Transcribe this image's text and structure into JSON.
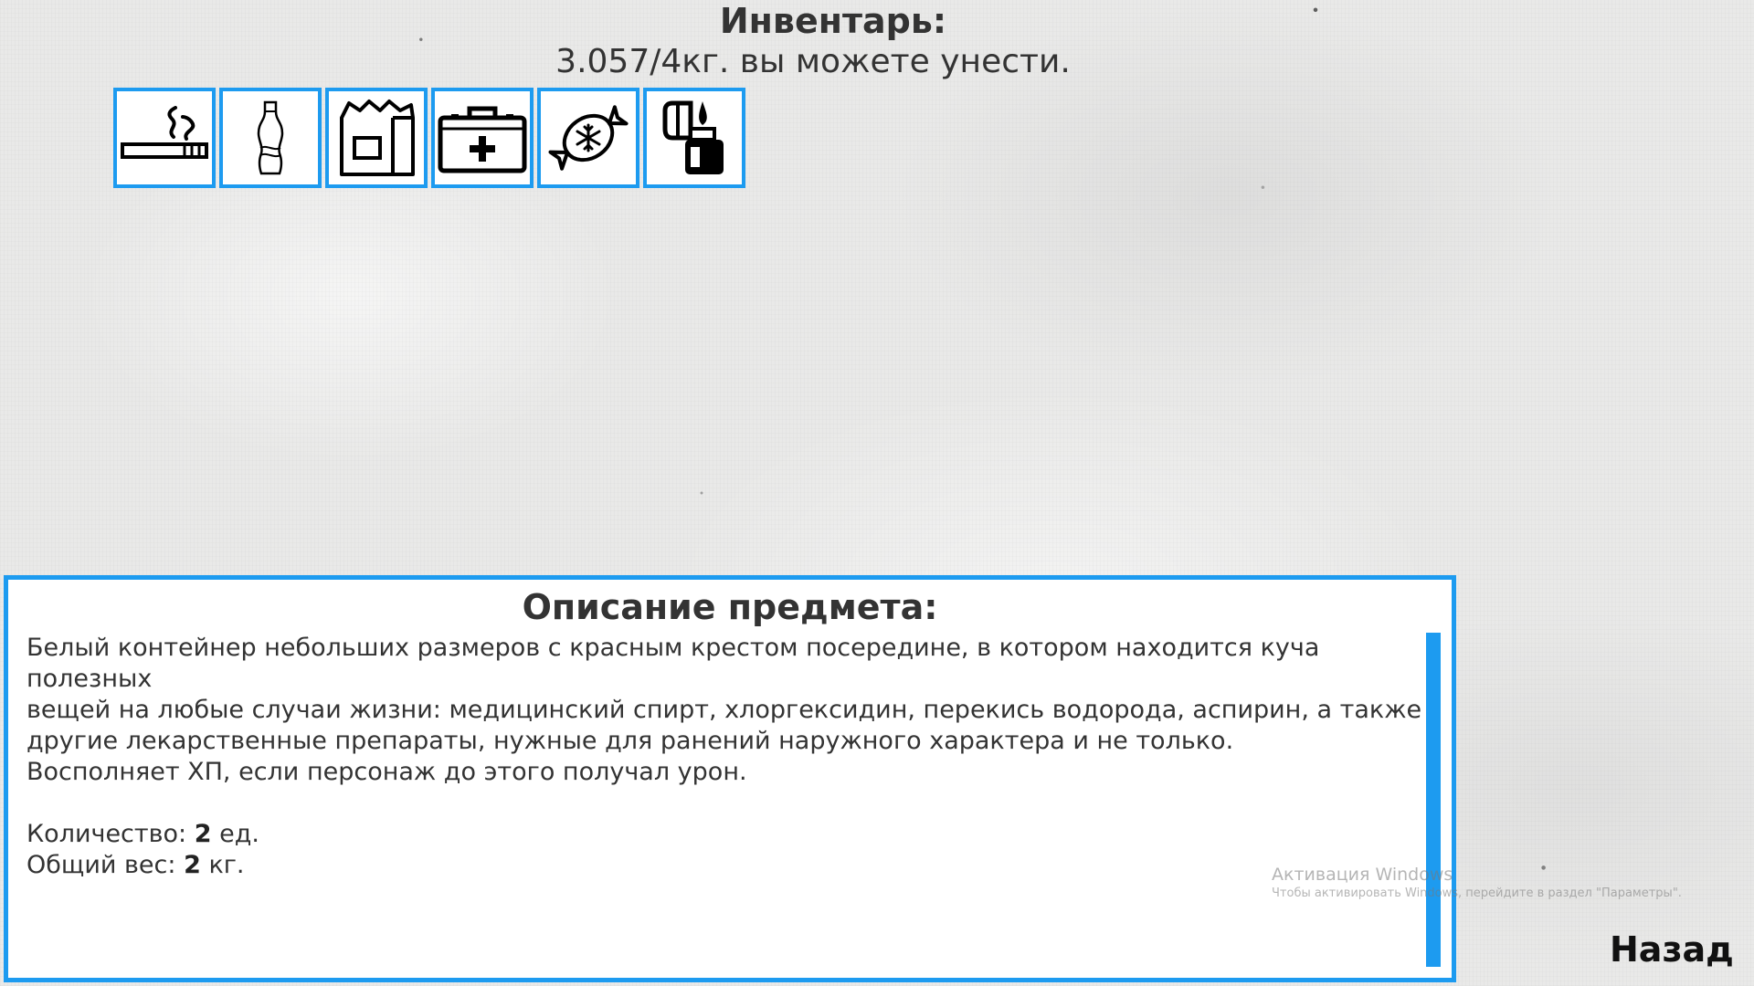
{
  "inventory": {
    "title": "Инвентарь:",
    "weight_text": "3.057/4кг. вы можете унести.",
    "accent_color": "#1d9bf0",
    "slots": [
      {
        "icon": "cigarette-icon"
      },
      {
        "icon": "soda-bottle-icon"
      },
      {
        "icon": "food-bag-icon"
      },
      {
        "icon": "first-aid-kit-icon"
      },
      {
        "icon": "candy-icon"
      },
      {
        "icon": "lighter-icon"
      }
    ]
  },
  "description": {
    "title": "Описание предмета:",
    "lines": [
      "Белый контейнер небольших размеров с красным крестом посередине, в котором находится куча полезных",
      "вещей на любые случаи жизни: медицинский спирт, хлоргексидин, перекись водорода, аспирин, а также",
      "другие лекарственные препараты, нужные для ранений наружного характера и не только.",
      "Восполняет ХП, если персонаж до этого получал урон."
    ],
    "quantity_label": "Количество: ",
    "quantity_value": "2",
    "quantity_unit": " ед.",
    "weight_label": "Общий вес: ",
    "weight_value": "2",
    "weight_unit": " кг."
  },
  "watermark": {
    "line1": "Активация Windows",
    "line2": "Чтобы активировать Windows, перейдите в раздел \"Параметры\"."
  },
  "back_label": "Назад"
}
